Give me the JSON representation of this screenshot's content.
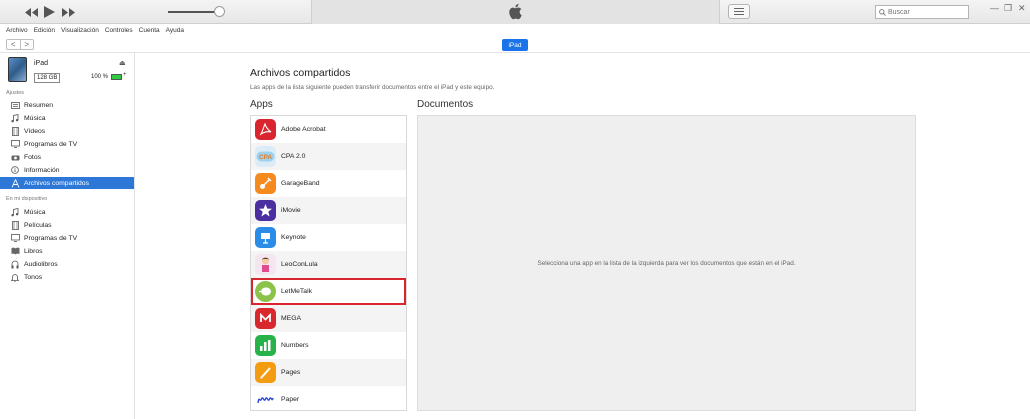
{
  "menu": [
    "Archivo",
    "Edición",
    "Visualización",
    "Controles",
    "Cuenta",
    "Ayuda"
  ],
  "search": {
    "placeholder": "Buscar"
  },
  "nav": {
    "back": "<",
    "forward": ">",
    "device_pill": "iPad"
  },
  "device": {
    "name": "iPad",
    "capacity": "128 GB",
    "battery": "100 %",
    "battery_level": 1.0
  },
  "sidebar": {
    "settings_title": "Ajustes",
    "settings": [
      "Resumen",
      "Música",
      "Vídeos",
      "Programas de TV",
      "Fotos",
      "Información",
      "Archivos compartidos"
    ],
    "ondevice_title": "En mi dispositivo",
    "ondevice": [
      "Música",
      "Películas",
      "Programas de TV",
      "Libros",
      "Audiolibros",
      "Tonos"
    ]
  },
  "main": {
    "title": "Archivos compartidos",
    "subtitle": "Las apps de la lista siguiente pueden transferir documentos entre el iPad y este equipo.",
    "apps_title": "Apps",
    "docs_title": "Documentos",
    "docs_empty": "Selecciona una app en la lista de la izquierda para ver los documentos que están en el iPad."
  },
  "apps": [
    {
      "name": "Adobe Acrobat",
      "icon": "adobe-acrobat-icon",
      "color": "#d9262e"
    },
    {
      "name": "CPA 2.0",
      "icon": "cpa-icon",
      "color": "#dcecf7"
    },
    {
      "name": "GarageBand",
      "icon": "garageband-icon",
      "color": "#f58a1f"
    },
    {
      "name": "iMovie",
      "icon": "imovie-icon",
      "color": "#4b2fa0"
    },
    {
      "name": "Keynote",
      "icon": "keynote-icon",
      "color": "#2a8ce6"
    },
    {
      "name": "LeoConLula",
      "icon": "leoconlula-icon",
      "color": "#f3e6ef"
    },
    {
      "name": "LetMeTalk",
      "icon": "letmetalk-icon",
      "color": "#8bc34a"
    },
    {
      "name": "MEGA",
      "icon": "mega-icon",
      "color": "#d9272e"
    },
    {
      "name": "Numbers",
      "icon": "numbers-icon",
      "color": "#27b24a"
    },
    {
      "name": "Pages",
      "icon": "pages-icon",
      "color": "#f39c12"
    },
    {
      "name": "Paper",
      "icon": "paper-icon",
      "color": "#2b4bd6"
    }
  ]
}
